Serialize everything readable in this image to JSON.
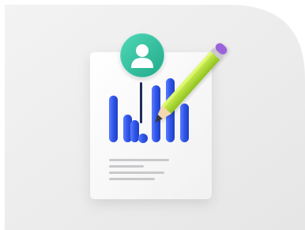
{
  "illustration": {
    "subject": "document-with-bar-chart-user-avatar-and-pencil",
    "icons": [
      "user-avatar-icon",
      "bar-chart-icon",
      "pencil-icon",
      "text-lines-icon"
    ],
    "bar_levels": [
      0.64,
      0.38,
      0.3,
      0.78,
      0.88,
      0.53
    ],
    "colors": {
      "background": "#ffffff",
      "backdrop": "#ededed",
      "document": "#fafafa",
      "avatar": "#35c6a5",
      "bars": "#2f56e8",
      "marker": "#1f2d5c",
      "pencil_body": "#b8e33a",
      "pencil_eraser": "#9b63d9",
      "text_lines": "#c9c9cc"
    }
  }
}
